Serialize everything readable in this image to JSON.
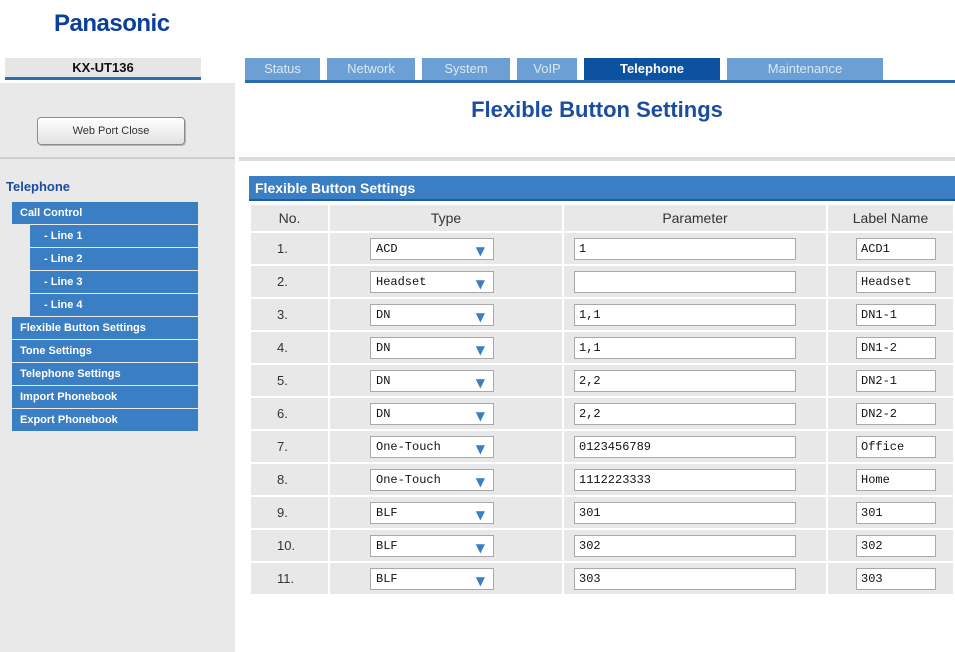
{
  "brand": "Panasonic",
  "model": "KX-UT136",
  "tabs": [
    {
      "label": "Status",
      "active": false
    },
    {
      "label": "Network",
      "active": false
    },
    {
      "label": "System",
      "active": false
    },
    {
      "label": "VoIP",
      "active": false
    },
    {
      "label": "Telephone",
      "active": true
    },
    {
      "label": "Maintenance",
      "active": false
    }
  ],
  "sidebar": {
    "close_button": "Web Port Close",
    "heading": "Telephone",
    "items": [
      {
        "label": "Call Control",
        "level": 1
      },
      {
        "label": "- Line 1",
        "level": 2
      },
      {
        "label": "- Line 2",
        "level": 2
      },
      {
        "label": "- Line 3",
        "level": 2
      },
      {
        "label": "- Line 4",
        "level": 2
      },
      {
        "label": "Flexible Button Settings",
        "level": 1
      },
      {
        "label": "Tone Settings",
        "level": 1
      },
      {
        "label": "Telephone Settings",
        "level": 1
      },
      {
        "label": "Import Phonebook",
        "level": 1
      },
      {
        "label": "Export Phonebook",
        "level": 1
      }
    ]
  },
  "page_title": "Flexible Button Settings",
  "section_title": "Flexible Button Settings",
  "table": {
    "headers": [
      "No.",
      "Type",
      "Parameter",
      "Label Name"
    ],
    "rows": [
      {
        "no": "1.",
        "type": "ACD",
        "parameter": "1",
        "label": "ACD1"
      },
      {
        "no": "2.",
        "type": "Headset",
        "parameter": "",
        "label": "Headset"
      },
      {
        "no": "3.",
        "type": "DN",
        "parameter": "1,1",
        "label": "DN1-1"
      },
      {
        "no": "4.",
        "type": "DN",
        "parameter": "1,1",
        "label": "DN1-2"
      },
      {
        "no": "5.",
        "type": "DN",
        "parameter": "2,2",
        "label": "DN2-1"
      },
      {
        "no": "6.",
        "type": "DN",
        "parameter": "2,2",
        "label": "DN2-2"
      },
      {
        "no": "7.",
        "type": "One-Touch",
        "parameter": "0123456789",
        "label": "Office"
      },
      {
        "no": "8.",
        "type": "One-Touch",
        "parameter": "1112223333",
        "label": "Home"
      },
      {
        "no": "9.",
        "type": "BLF",
        "parameter": "301",
        "label": "301"
      },
      {
        "no": "10.",
        "type": "BLF",
        "parameter": "302",
        "label": "302"
      },
      {
        "no": "11.",
        "type": "BLF",
        "parameter": "303",
        "label": "303"
      }
    ]
  },
  "icons": {
    "dropdown": "chevron-down-icon"
  },
  "colors": {
    "brand": "#0a3f9a",
    "accent": "#3a7ec4",
    "tab_active": "#0d52a0",
    "tab_inactive": "#6c9fd3"
  }
}
